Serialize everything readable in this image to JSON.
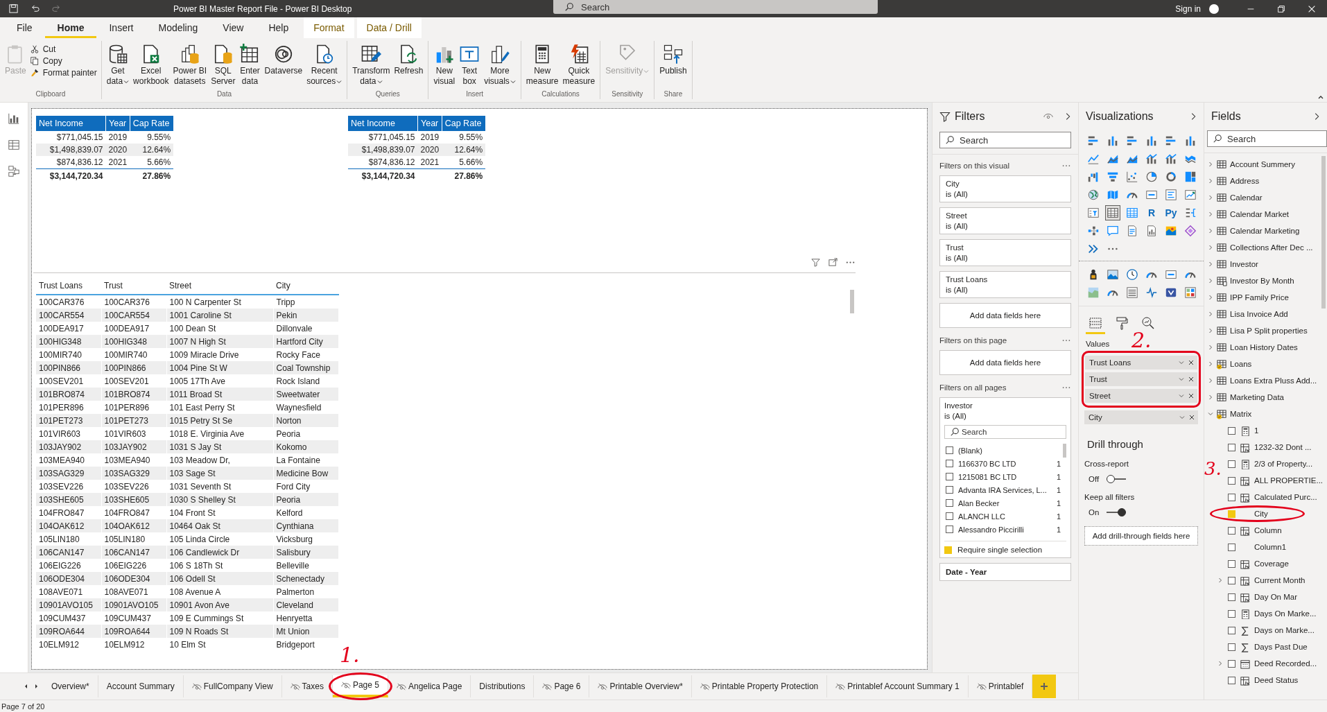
{
  "window": {
    "title": "Power BI Master Report File - Power BI Desktop",
    "search": {
      "placeholder": "Search"
    },
    "sign_in": "Sign in"
  },
  "menu_tabs": [
    {
      "label": "File",
      "selected": false,
      "kind": "main"
    },
    {
      "label": "Home",
      "selected": true,
      "kind": "main"
    },
    {
      "label": "Insert",
      "selected": false,
      "kind": "main"
    },
    {
      "label": "Modeling",
      "selected": false,
      "kind": "main"
    },
    {
      "label": "View",
      "selected": false,
      "kind": "main"
    },
    {
      "label": "Help",
      "selected": false,
      "kind": "main"
    },
    {
      "label": "Format",
      "selected": false,
      "kind": "contextual"
    },
    {
      "label": "Data / Drill",
      "selected": false,
      "kind": "contextual"
    }
  ],
  "ribbon": [
    {
      "group": "Clipboard",
      "buttons": [
        {
          "kind": "large",
          "lines": [
            "Paste"
          ],
          "disabled": true,
          "caret": false
        },
        {
          "kind": "small",
          "lines": [
            "Cut"
          ],
          "disabled": false,
          "caret": false
        },
        {
          "kind": "small",
          "lines": [
            "Copy"
          ],
          "disabled": false,
          "caret": false
        },
        {
          "kind": "small",
          "lines": [
            "Format painter"
          ],
          "disabled": false,
          "caret": false
        }
      ]
    },
    {
      "group": "Data",
      "buttons": [
        {
          "kind": "large",
          "lines": [
            "Get",
            "data"
          ],
          "disabled": false,
          "caret": true
        },
        {
          "kind": "large",
          "lines": [
            "Excel",
            "workbook"
          ],
          "disabled": false,
          "caret": false
        },
        {
          "kind": "large",
          "lines": [
            "Power BI",
            "datasets"
          ],
          "disabled": false,
          "caret": false
        },
        {
          "kind": "large",
          "lines": [
            "SQL",
            "Server"
          ],
          "disabled": false,
          "caret": false
        },
        {
          "kind": "large",
          "lines": [
            "Enter",
            "data"
          ],
          "disabled": false,
          "caret": false
        },
        {
          "kind": "large",
          "lines": [
            "Dataverse"
          ],
          "disabled": false,
          "caret": false
        },
        {
          "kind": "large",
          "lines": [
            "Recent",
            "sources"
          ],
          "disabled": false,
          "caret": true
        }
      ]
    },
    {
      "group": "Queries",
      "buttons": [
        {
          "kind": "large",
          "lines": [
            "Transform",
            "data"
          ],
          "disabled": false,
          "caret": true
        },
        {
          "kind": "large",
          "lines": [
            "Refresh"
          ],
          "disabled": false,
          "caret": false
        }
      ]
    },
    {
      "group": "Insert",
      "buttons": [
        {
          "kind": "large",
          "lines": [
            "New",
            "visual"
          ],
          "disabled": false,
          "caret": false
        },
        {
          "kind": "large",
          "lines": [
            "Text",
            "box"
          ],
          "disabled": false,
          "caret": false
        },
        {
          "kind": "large",
          "lines": [
            "More",
            "visuals"
          ],
          "disabled": false,
          "caret": true
        }
      ]
    },
    {
      "group": "Calculations",
      "buttons": [
        {
          "kind": "large",
          "lines": [
            "New",
            "measure"
          ],
          "disabled": false,
          "caret": false
        },
        {
          "kind": "large",
          "lines": [
            "Quick",
            "measure"
          ],
          "disabled": false,
          "caret": false
        }
      ]
    },
    {
      "group": "Sensitivity",
      "buttons": [
        {
          "kind": "large",
          "lines": [
            "Sensitivity"
          ],
          "disabled": true,
          "caret": true
        }
      ]
    },
    {
      "group": "Share",
      "buttons": [
        {
          "kind": "large",
          "lines": [
            "Publish"
          ],
          "disabled": false,
          "caret": false
        }
      ]
    }
  ],
  "canvas": {
    "tables": [
      {
        "columns": [
          "Net Income",
          "Year",
          "Cap Rate"
        ],
        "rows": [
          [
            "$771,045.15",
            "2019",
            "9.55%"
          ],
          [
            "$1,498,839.07",
            "2020",
            "12.64%"
          ],
          [
            "$874,836.12",
            "2021",
            "5.66%"
          ]
        ],
        "total": {
          "net_income": "$3,144,720.34",
          "cap_rate": "27.86%"
        }
      },
      {
        "columns": [
          "Net Income",
          "Year",
          "Cap Rate"
        ],
        "rows": [
          [
            "$771,045.15",
            "2019",
            "9.55%"
          ],
          [
            "$1,498,839.07",
            "2020",
            "12.64%"
          ],
          [
            "$874,836.12",
            "2021",
            "5.66%"
          ]
        ],
        "total": {
          "net_income": "$3,144,720.34",
          "cap_rate": "27.86%"
        }
      }
    ],
    "grid": {
      "columns": [
        "Trust Loans",
        "Trust",
        "Street",
        "City"
      ],
      "rows": [
        [
          "100CAR376",
          "100CAR376",
          "100 N Carpenter St",
          "Tripp"
        ],
        [
          "100CAR554",
          "100CAR554",
          "1001 Caroline St",
          "Pekin"
        ],
        [
          "100DEA917",
          "100DEA917",
          "100 Dean St",
          "Dillonvale"
        ],
        [
          "100HIG348",
          "100HIG348",
          "1007 N High St",
          "Hartford City"
        ],
        [
          "100MIR740",
          "100MIR740",
          "1009 Miracle Drive",
          "Rocky Face"
        ],
        [
          "100PIN866",
          "100PIN866",
          "1004 Pine St W",
          "Coal Township"
        ],
        [
          "100SEV201",
          "100SEV201",
          "1005 17Th Ave",
          "Rock Island"
        ],
        [
          "101BRO874",
          "101BRO874",
          "1011 Broad St",
          "Sweetwater"
        ],
        [
          "101PER896",
          "101PER896",
          "101 East Perry St",
          "Waynesfield"
        ],
        [
          "101PET273",
          "101PET273",
          "1015 Petry St Se",
          "Norton"
        ],
        [
          "101VIR603",
          "101VIR603",
          "1018 E. Virginia Ave",
          "Peoria"
        ],
        [
          "103JAY902",
          "103JAY902",
          "1031 S Jay St",
          "Kokomo"
        ],
        [
          "103MEA940",
          "103MEA940",
          "103 Meadow Dr,",
          "La Fontaine"
        ],
        [
          "103SAG329",
          "103SAG329",
          "103 Sage St",
          "Medicine Bow"
        ],
        [
          "103SEV226",
          "103SEV226",
          "1031 Seventh St",
          "Ford City"
        ],
        [
          "103SHE605",
          "103SHE605",
          "1030 S Shelley St",
          "Peoria"
        ],
        [
          "104FRO847",
          "104FRO847",
          "104 Front St",
          "Kelford"
        ],
        [
          "104OAK612",
          "104OAK612",
          "10464 Oak St",
          "Cynthiana"
        ],
        [
          "105LIN180",
          "105LIN180",
          "105 Linda Circle",
          "Vicksburg"
        ],
        [
          "106CAN147",
          "106CAN147",
          "106 Candlewick Dr",
          "Salisbury"
        ],
        [
          "106EIG226",
          "106EIG226",
          "106 S 18Th St",
          "Belleville"
        ],
        [
          "106ODE304",
          "106ODE304",
          "106 Odell St",
          "Schenectady"
        ],
        [
          "108AVE071",
          "108AVE071",
          "108 Avenue A",
          "Palmerton"
        ],
        [
          "10901AVO105",
          "10901AVO105",
          "10901 Avon Ave",
          "Cleveland"
        ],
        [
          "109CUM437",
          "109CUM437",
          "109 E Cummings St",
          "Henryetta"
        ],
        [
          "109ROA644",
          "109ROA644",
          "109 N Roads St",
          "Mt Union"
        ],
        [
          "10ELM912",
          "10ELM912",
          "10 Elm St",
          "Bridgeport"
        ]
      ]
    }
  },
  "filters": {
    "title": "Filters",
    "search": {
      "placeholder": "Search"
    },
    "sections": [
      {
        "title": "Filters on this visual",
        "cards": [
          {
            "kind": "basic",
            "field": "City",
            "condition": "is (All)"
          },
          {
            "kind": "basic",
            "field": "Street",
            "condition": "is (All)"
          },
          {
            "kind": "basic",
            "field": "Trust",
            "condition": "is (All)"
          },
          {
            "kind": "basic",
            "field": "Trust Loans",
            "condition": "is (All)"
          }
        ],
        "drop_hint": "Add data fields here"
      },
      {
        "title": "Filters on this page",
        "drop_hint": "Add data fields here"
      },
      {
        "title": "Filters on all pages",
        "cards": [
          {
            "kind": "expanded",
            "field": "Investor",
            "condition": "is (All)",
            "search": {
              "placeholder": "Search"
            },
            "items": [
              {
                "label": "(Blank)",
                "checked": false
              },
              {
                "label": "1166370 BC LTD",
                "count": "1",
                "checked": false
              },
              {
                "label": "1215081 BC LTD",
                "count": "1",
                "checked": false
              },
              {
                "label": "Advanta IRA Services, L...",
                "count": "1",
                "checked": false
              },
              {
                "label": "Alan Becker",
                "count": "1",
                "checked": false
              },
              {
                "label": "ALANCH LLC",
                "count": "1",
                "checked": false
              },
              {
                "label": "Alessandro Piccirilli",
                "count": "1",
                "checked": false
              }
            ],
            "require_single": {
              "label": "Require single selection",
              "checked": true
            }
          },
          {
            "kind": "collapsed",
            "field": "Date - Year"
          }
        ]
      }
    ]
  },
  "visualizations": {
    "title": "Visualizations",
    "gallery": [
      {
        "selected": false
      },
      {
        "selected": false
      },
      {
        "selected": false
      },
      {
        "selected": false
      },
      {
        "selected": false
      },
      {
        "selected": false
      },
      {
        "selected": false
      },
      {
        "selected": false
      },
      {
        "selected": false
      },
      {
        "selected": false
      },
      {
        "selected": false
      },
      {
        "selected": false
      },
      {
        "selected": false
      },
      {
        "selected": false
      },
      {
        "selected": false
      },
      {
        "selected": false
      },
      {
        "selected": false
      },
      {
        "selected": false
      },
      {
        "selected": false
      },
      {
        "selected": false
      },
      {
        "selected": false
      },
      {
        "selected": false
      },
      {
        "selected": false
      },
      {
        "selected": false
      },
      {
        "selected": false
      },
      {
        "selected": true
      },
      {
        "selected": false
      },
      {
        "text": "R",
        "selected": false
      },
      {
        "text": "Py",
        "selected": false
      },
      {
        "selected": false
      },
      {
        "selected": false
      },
      {
        "selected": false
      },
      {
        "selected": false
      },
      {
        "selected": false
      },
      {
        "selected": false
      },
      {
        "selected": false
      },
      {
        "selected": false
      },
      {
        "selected": false
      }
    ],
    "custom": [
      {
        "selected": false
      },
      {
        "selected": false
      },
      {
        "selected": false
      },
      {
        "selected": false
      },
      {
        "selected": false
      },
      {
        "selected": false
      },
      {
        "selected": false
      },
      {
        "selected": false
      },
      {
        "selected": false
      },
      {
        "selected": false
      },
      {
        "selected": false
      },
      {
        "selected": false
      }
    ],
    "panel_tabs": [
      {
        "kind": "fields",
        "selected": true
      },
      {
        "kind": "format",
        "selected": false
      },
      {
        "kind": "analytics",
        "selected": false
      }
    ],
    "values_label": "Values",
    "annotation": "2.",
    "wells": [
      {
        "label": "Trust Loans",
        "circled": true
      },
      {
        "label": "Trust",
        "circled": true
      },
      {
        "label": "Street",
        "circled": true
      },
      {
        "label": "City",
        "circled": false
      }
    ],
    "drill": {
      "title": "Drill through",
      "cross_report": {
        "label": "Cross-report",
        "state": "Off",
        "on": false
      },
      "keep_filters": {
        "label": "Keep all filters",
        "state": "On",
        "on": true
      },
      "drop_hint": "Add drill-through fields here"
    }
  },
  "fields": {
    "title": "Fields",
    "search": {
      "placeholder": "Search"
    },
    "annotation": "3.",
    "tables": [
      {
        "label": "Account Summery",
        "kind": "table",
        "in_use": false,
        "expanded": false
      },
      {
        "label": "Address",
        "kind": "table",
        "in_use": false,
        "expanded": false
      },
      {
        "label": "Calendar",
        "kind": "table",
        "in_use": false,
        "expanded": false
      },
      {
        "label": "Calendar Market",
        "kind": "table",
        "in_use": false,
        "expanded": false
      },
      {
        "label": "Calendar Marketing",
        "kind": "table",
        "in_use": false,
        "expanded": false
      },
      {
        "label": "Collections After Dec ...",
        "kind": "table",
        "in_use": false,
        "expanded": false
      },
      {
        "label": "Investor",
        "kind": "table",
        "in_use": false,
        "expanded": false
      },
      {
        "label": "Investor By Month",
        "kind": "calc_table",
        "in_use": false,
        "expanded": false
      },
      {
        "label": "IPP Family Price",
        "kind": "table",
        "in_use": false,
        "expanded": false
      },
      {
        "label": "Lisa Invoice Add",
        "kind": "table",
        "in_use": false,
        "expanded": false
      },
      {
        "label": "Lisa P Split properties",
        "kind": "table",
        "in_use": false,
        "expanded": false
      },
      {
        "label": "Loan History Dates",
        "kind": "table",
        "in_use": false,
        "expanded": false
      },
      {
        "label": "Loans",
        "kind": "table",
        "in_use": true,
        "expanded": false
      },
      {
        "label": "Loans Extra Pluss Add...",
        "kind": "table",
        "in_use": false,
        "expanded": false
      },
      {
        "label": "Marketing Data",
        "kind": "table",
        "in_use": false,
        "expanded": false
      },
      {
        "label": "Matrix",
        "kind": "table",
        "in_use": true,
        "expanded": true,
        "children": [
          {
            "label": "1",
            "kind": "calc",
            "checked": false,
            "expandable": false,
            "circled": false
          },
          {
            "label": "1232-32 Dont ...",
            "kind": "formula",
            "checked": false,
            "expandable": false,
            "circled": false
          },
          {
            "label": "2/3 of Property...",
            "kind": "calc",
            "checked": false,
            "expandable": false,
            "circled": false
          },
          {
            "label": "ALL PROPERTIE...",
            "kind": "formula",
            "checked": false,
            "expandable": false,
            "circled": false
          },
          {
            "label": "Calculated Purc...",
            "kind": "formula",
            "checked": false,
            "expandable": false,
            "circled": false
          },
          {
            "label": "City",
            "kind": "plain",
            "checked": true,
            "expandable": false,
            "circled": true
          },
          {
            "label": "Column",
            "kind": "formula",
            "checked": false,
            "expandable": false,
            "circled": false
          },
          {
            "label": "Column1",
            "kind": "plain",
            "checked": false,
            "expandable": false,
            "circled": false
          },
          {
            "label": "Coverage",
            "kind": "formula",
            "checked": false,
            "expandable": false,
            "circled": false
          },
          {
            "label": "Current Month",
            "kind": "formula",
            "checked": false,
            "expandable": true,
            "circled": false
          },
          {
            "label": "Day On Mar",
            "kind": "formula",
            "checked": false,
            "expandable": false,
            "circled": false
          },
          {
            "label": "Days On Marke...",
            "kind": "calc",
            "checked": false,
            "expandable": false,
            "circled": false
          },
          {
            "label": "Days on Marke...",
            "kind": "sigma",
            "checked": false,
            "expandable": false,
            "circled": false
          },
          {
            "label": "Days Past Due",
            "kind": "sigma",
            "checked": false,
            "expandable": false,
            "circled": false
          },
          {
            "label": "Deed Recorded...",
            "kind": "calendar",
            "checked": false,
            "expandable": true,
            "circled": false
          },
          {
            "label": "Deed Status",
            "kind": "formula",
            "checked": false,
            "expandable": false,
            "circled": false
          }
        ]
      }
    ]
  },
  "pages": {
    "annotation": "1.",
    "items": [
      {
        "label": "Overview*",
        "hidden": false,
        "selected": false,
        "circled": false
      },
      {
        "label": "Account Summary",
        "hidden": false,
        "selected": false,
        "circled": false
      },
      {
        "label": "FullCompany View",
        "hidden": true,
        "selected": false,
        "circled": false
      },
      {
        "label": "Taxes",
        "hidden": true,
        "selected": false,
        "circled": false
      },
      {
        "label": "Page 5",
        "hidden": true,
        "selected": true,
        "circled": true
      },
      {
        "label": "Angelica Page",
        "hidden": true,
        "selected": false,
        "circled": false
      },
      {
        "label": "Distributions",
        "hidden": false,
        "selected": false,
        "circled": false
      },
      {
        "label": "Page 6",
        "hidden": true,
        "selected": false,
        "circled": false
      },
      {
        "label": "Printable Overview*",
        "hidden": true,
        "selected": false,
        "circled": false
      },
      {
        "label": "Printable Property Protection",
        "hidden": true,
        "selected": false,
        "circled": false
      },
      {
        "label": "Printablef Account Summary 1",
        "hidden": true,
        "selected": false,
        "circled": false
      },
      {
        "label": "Printablef",
        "hidden": true,
        "selected": false,
        "circled": false
      }
    ]
  },
  "status_bar": "Page 7 of 20"
}
